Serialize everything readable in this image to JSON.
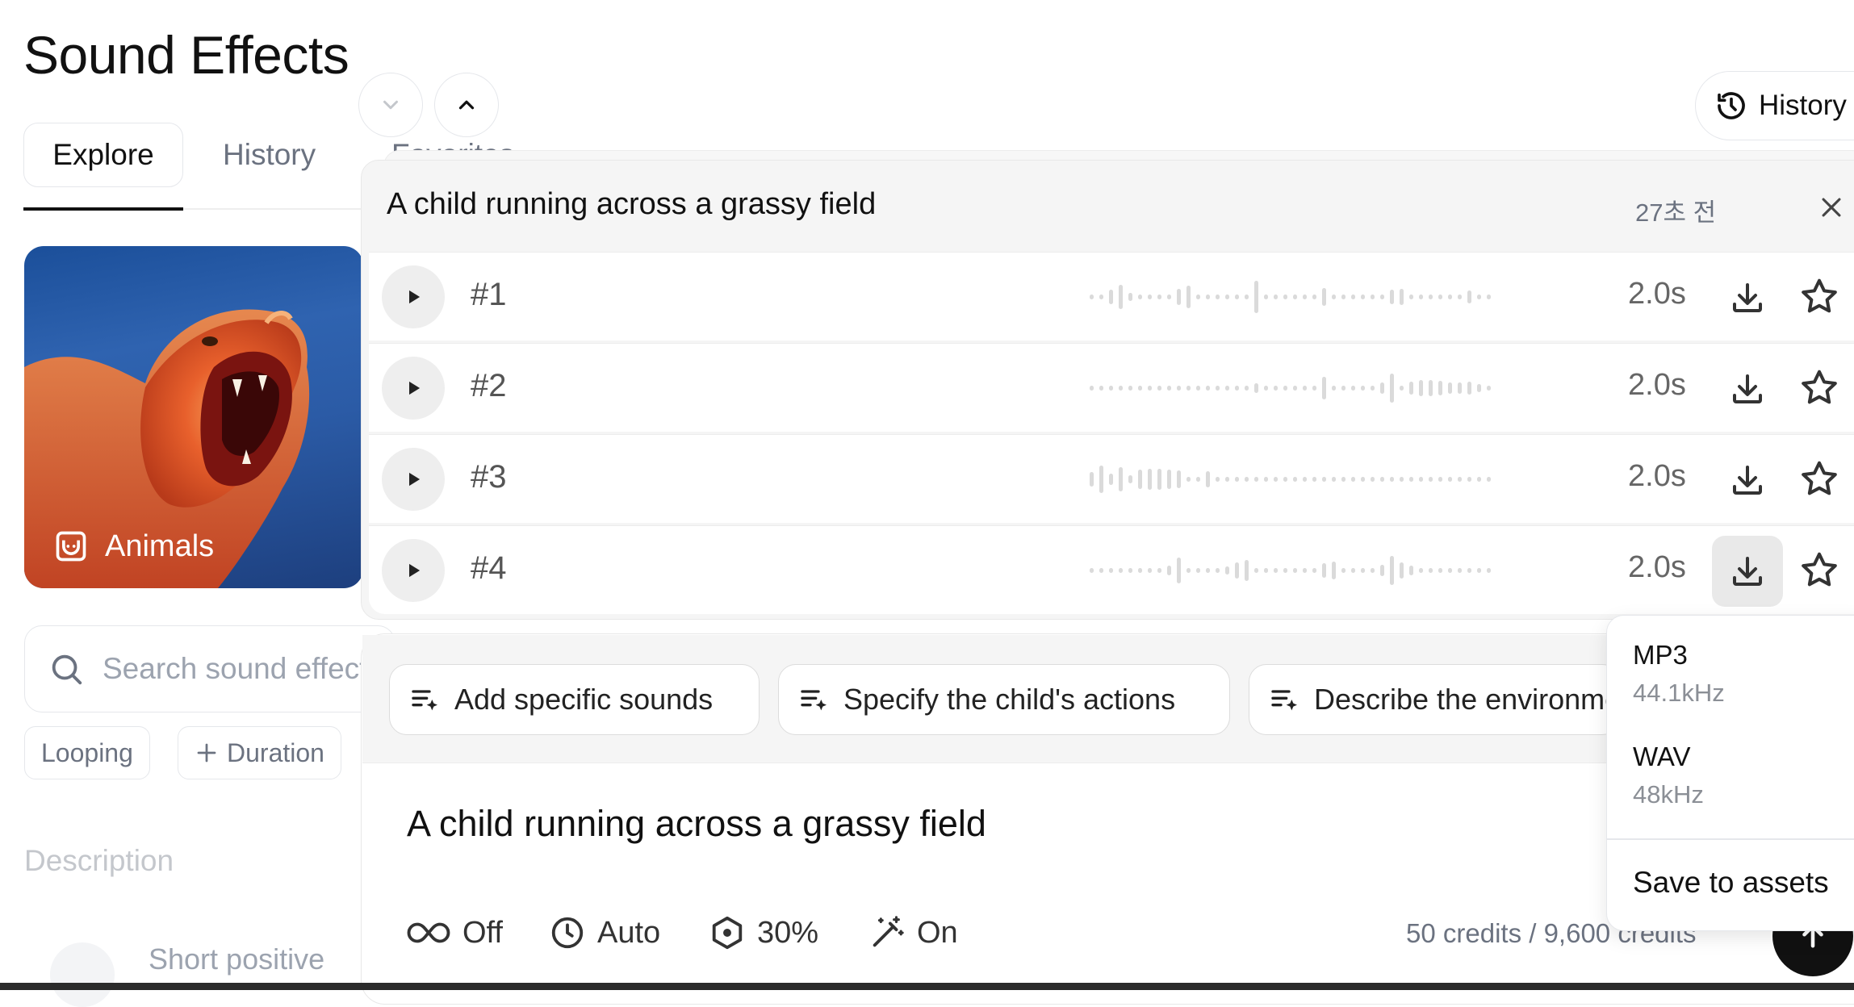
{
  "page": {
    "title": "Sound Effects"
  },
  "tabs": [
    {
      "label": "Explore",
      "active": true
    },
    {
      "label": "History"
    },
    {
      "label": "Favorites"
    }
  ],
  "history_button": {
    "label": "History",
    "icon": "history-icon"
  },
  "category_card": {
    "label": "Animals",
    "icon": "animal-icon"
  },
  "search": {
    "placeholder": "Search sound effects..."
  },
  "filters": [
    {
      "label": "Looping"
    },
    {
      "label": "Duration",
      "icon": "plus-icon"
    }
  ],
  "description_label": "Description",
  "list_preview": "Short positive",
  "generation": {
    "title": "A child running across a grassy field",
    "time_ago": "27초 전",
    "results": [
      {
        "label": "#1",
        "duration": "2.0s"
      },
      {
        "label": "#2",
        "duration": "2.0s"
      },
      {
        "label": "#3",
        "duration": "2.0s"
      },
      {
        "label": "#4",
        "duration": "2.0s",
        "download_active": true
      }
    ]
  },
  "suggestions": [
    {
      "label": "Add specific sounds"
    },
    {
      "label": "Specify the child's actions"
    },
    {
      "label": "Describe the environment"
    }
  ],
  "prompt": {
    "text": "A child running across a grassy field",
    "options": [
      {
        "icon": "loop-icon",
        "label": "Off"
      },
      {
        "icon": "clock-icon",
        "label": "Auto"
      },
      {
        "icon": "influence-icon",
        "label": "30%"
      },
      {
        "icon": "magic-wand-icon",
        "label": "On"
      }
    ],
    "credits": "50 credits / 9,600 credits"
  },
  "download_menu": {
    "formats": [
      {
        "format": "MP3",
        "quality": "44.1kHz"
      },
      {
        "format": "WAV",
        "quality": "48kHz"
      }
    ],
    "save_label": "Save to assets"
  },
  "colors": {
    "text_primary": "#111111",
    "text_muted": "#6b7280",
    "panel_bg": "#f5f5f5",
    "card_orange": "#e8602c",
    "card_blue": "#1d4f9a",
    "send_button": "#111111"
  }
}
